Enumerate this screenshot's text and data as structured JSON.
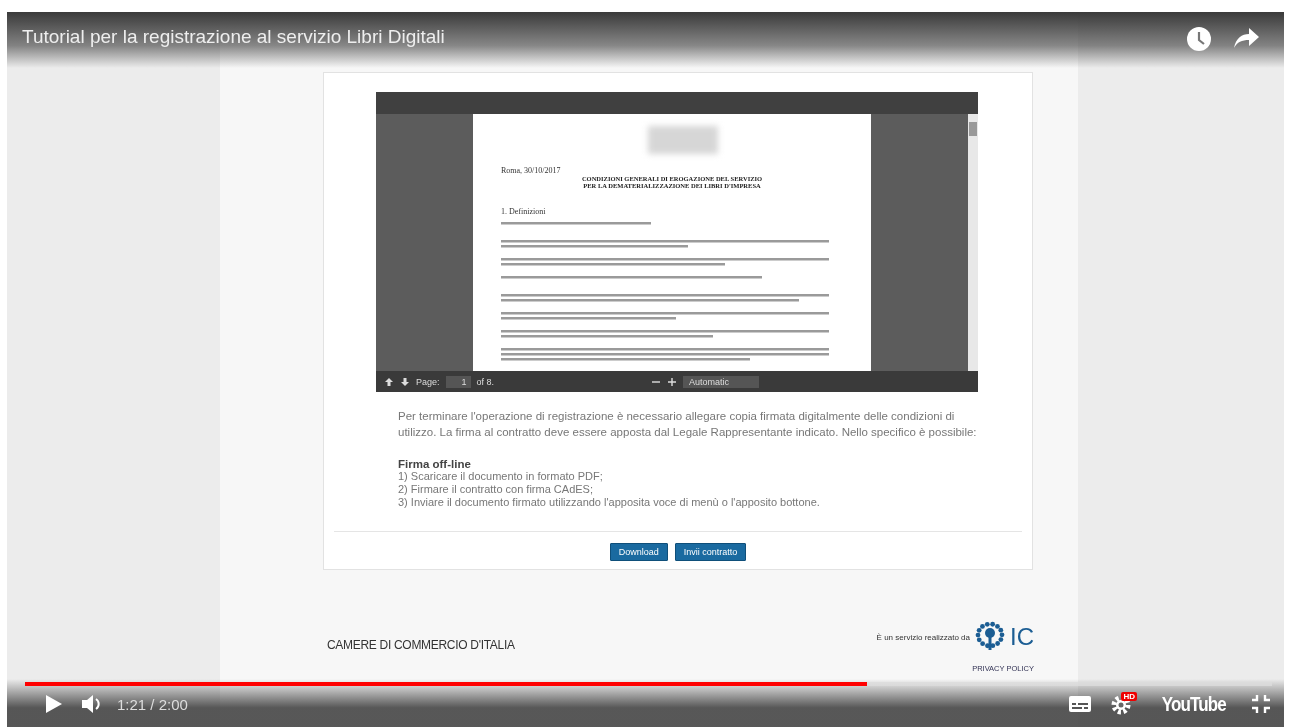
{
  "player": {
    "title": "Tutorial per la registrazione al servizio Libri Digitali",
    "time": "1:21 / 2:00",
    "quality_badge": "HD",
    "logo": "YouTube",
    "progress": {
      "level": 0.675
    }
  },
  "frame": {
    "pdf_viewer": {
      "date": "Roma, 30/10/2017",
      "heading": [
        "CONDIZIONI GENERALI DI EROGAZIONE DEL SERVIZIO",
        "PER LA DEMATERIALIZZAZIONE DEI LIBRI D'IMPRESA"
      ],
      "section": "1. Definizioni",
      "page_label": "Page:",
      "page_number": "1",
      "page_count": "of 8.",
      "zoom": "Automatic"
    },
    "paragraph": "Per terminare l'operazione di registrazione è necessario allegare copia firmata digitalmente delle condizioni di utilizzo. La firma al contratto deve essere apposta dal Legale Rappresentante indicato. Nello specifico è possibile:",
    "offline_title": "Firma off-line",
    "steps": [
      "1) Scaricare il documento in formato PDF;",
      "2) Firmare il contratto con firma CAdES;",
      "3) Inviare il documento firmato utilizzando l'apposita voce di menù o l'apposito bottone."
    ],
    "buttons": [
      "Download",
      "Invii contratto"
    ],
    "footer": {
      "brand": "CAMERE DI COMMERCIO D'ITALIA",
      "credit": "È un servizio realizzato da",
      "logo_text": "IC",
      "privacy": "PRIVACY POLICY"
    }
  }
}
